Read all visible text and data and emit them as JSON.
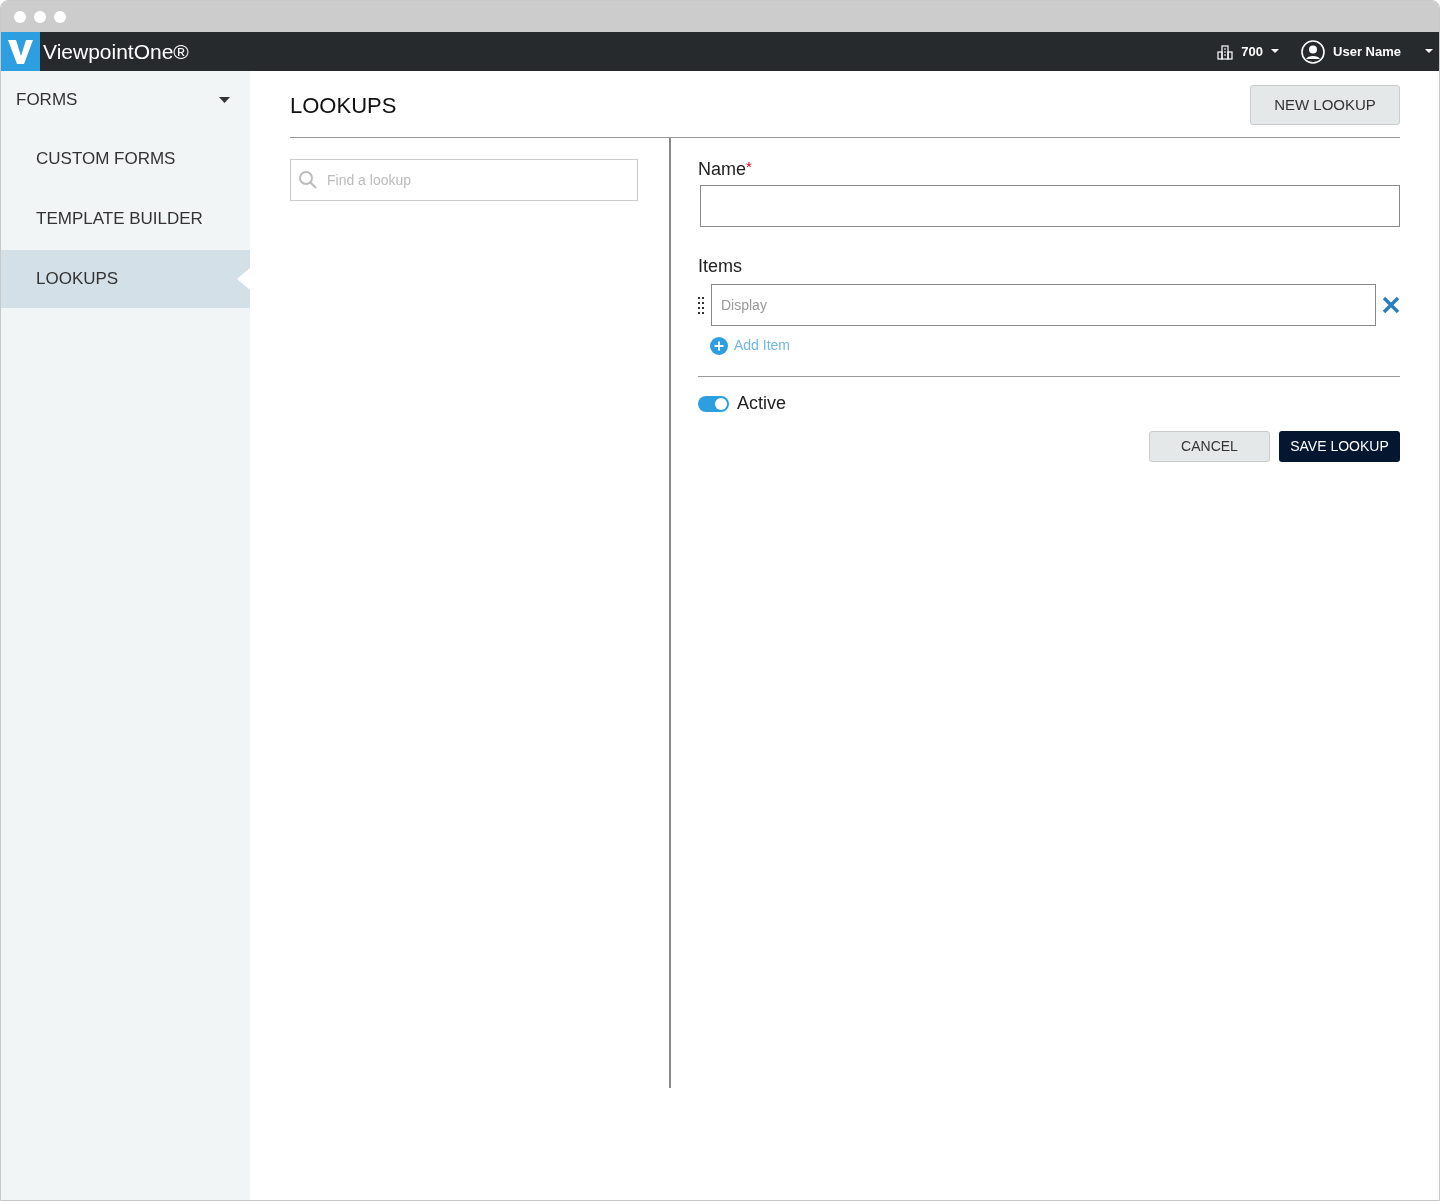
{
  "app_bar": {
    "brand": "ViewpointOne®",
    "company": "700",
    "user": "User Name"
  },
  "sidebar": {
    "section": {
      "label": "FORMS",
      "expanded": true
    },
    "items": [
      {
        "label": "CUSTOM FORMS",
        "selected": false
      },
      {
        "label": "TEMPLATE BUILDER",
        "selected": false
      },
      {
        "label": "LOOKUPS",
        "selected": true
      }
    ]
  },
  "page": {
    "title": "LOOKUPS",
    "new_button": "NEW LOOKUP"
  },
  "search": {
    "placeholder": "Find a lookup"
  },
  "form": {
    "name_label": "Name",
    "required_mark": "*",
    "items_label": "Items",
    "items": [
      {
        "placeholder": "Display"
      }
    ],
    "add_item": "Add Item",
    "active": {
      "label": "Active",
      "on": true
    },
    "cancel": "CANCEL",
    "save": "SAVE LOOKUP"
  }
}
